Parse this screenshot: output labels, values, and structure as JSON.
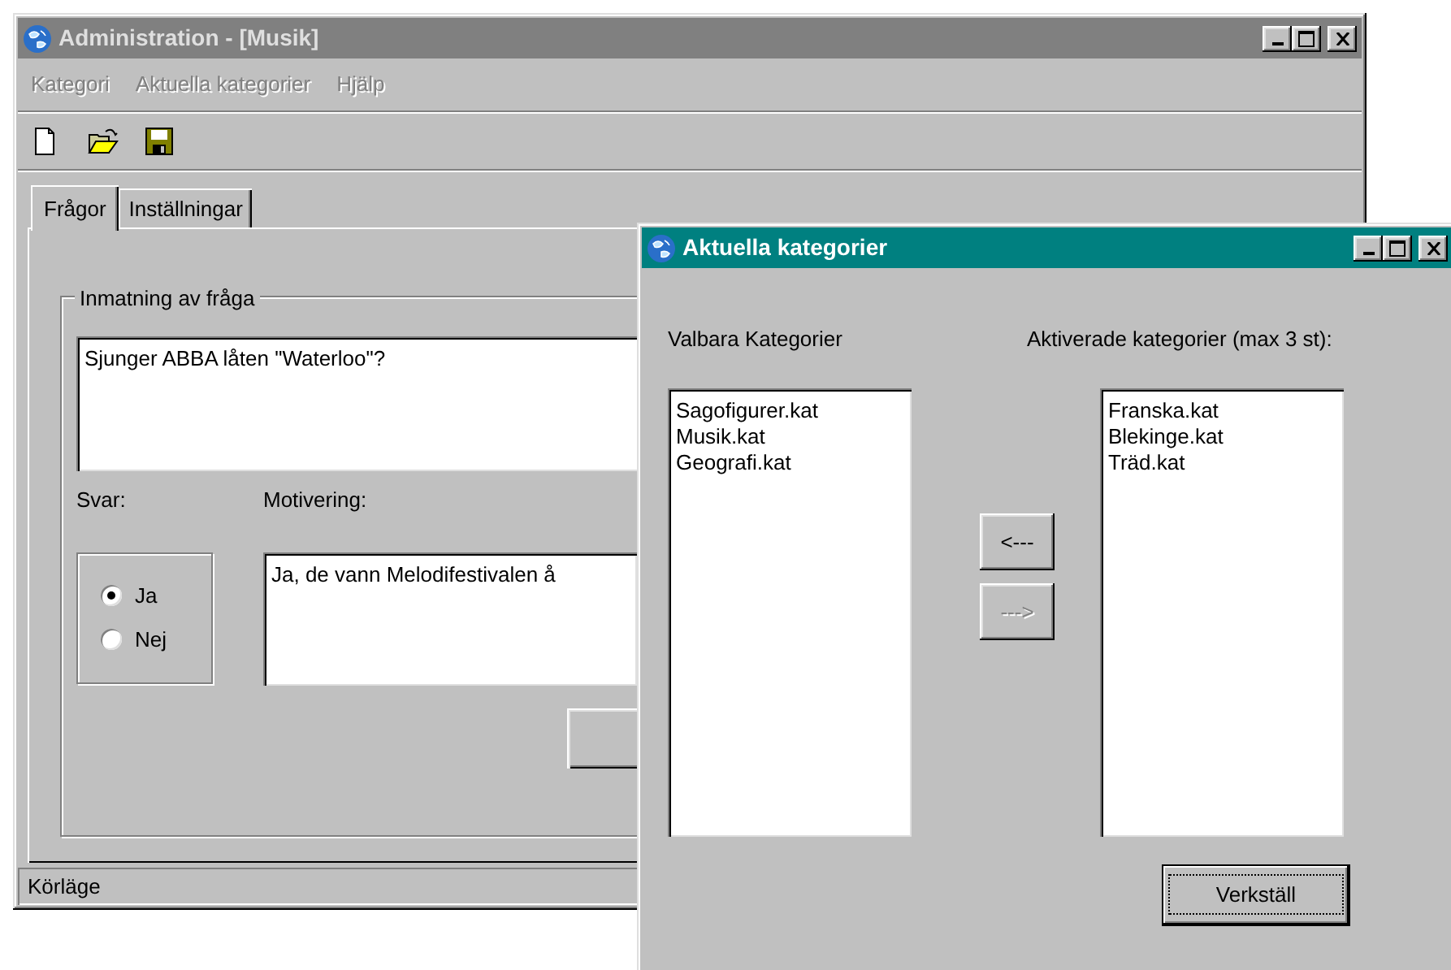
{
  "main_window": {
    "title": "Administration - [Musik]",
    "menu": [
      {
        "label": "Kategori",
        "disabled": true
      },
      {
        "label": "Aktuella kategorier",
        "disabled": true
      },
      {
        "label": "Hjälp",
        "disabled": true
      }
    ],
    "toolbar": [
      {
        "kind": "new"
      },
      {
        "kind": "open"
      },
      {
        "kind": "save"
      }
    ],
    "tabs": [
      {
        "label": "Frågor",
        "selected": true
      },
      {
        "label": "Inställningar",
        "selected": false
      }
    ],
    "group_title": "Inmatning av fråga",
    "question": "Sjunger ABBA låten \"Waterloo\"?",
    "answer_label": "Svar:",
    "answers": [
      {
        "label": "Ja",
        "selected": true
      },
      {
        "label": "Nej",
        "selected": false
      }
    ],
    "motivation_label": "Motivering:",
    "motivation": "Ja, de vann Melodifestivalen å",
    "status_bar": "Körläge"
  },
  "dialog": {
    "title": "Aktuella kategorier",
    "available_label": "Valbara Kategorier",
    "available": [
      "Sagofigurer.kat",
      "Musik.kat",
      "Geografi.kat"
    ],
    "active_label": "Aktiverade kategorier (max 3 st):",
    "active": [
      "Franska.kat",
      "Blekinge.kat",
      "Träd.kat"
    ],
    "move_buttons": [
      {
        "label": "<---",
        "disabled": false
      },
      {
        "label": "--->",
        "disabled": true
      }
    ],
    "apply_button": "Verkställ"
  }
}
